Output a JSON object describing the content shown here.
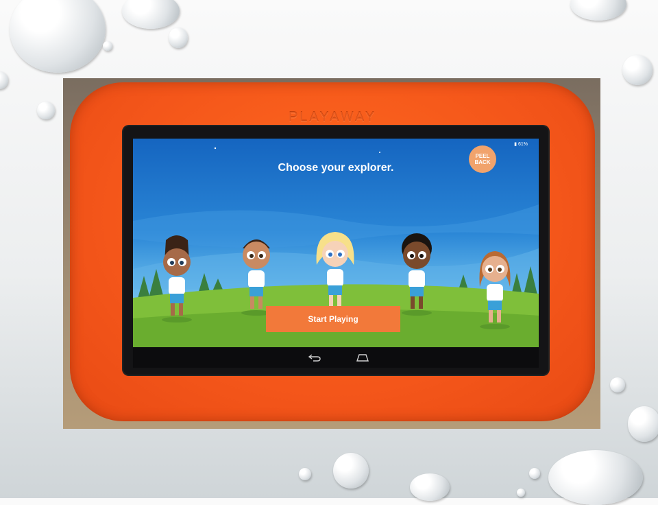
{
  "device": {
    "brand": "PLAYAWAY",
    "status": {
      "battery": "61%"
    }
  },
  "app": {
    "title": "Choose your explorer.",
    "peel_back": "PEEL BACK",
    "start_button": "Start Playing",
    "explorers": [
      {
        "name": "explorer-1",
        "selected": false
      },
      {
        "name": "explorer-2",
        "selected": false
      },
      {
        "name": "explorer-3",
        "selected": true
      },
      {
        "name": "explorer-4",
        "selected": false
      },
      {
        "name": "explorer-5",
        "selected": false
      }
    ]
  },
  "navbar": {
    "icons": [
      "back-icon",
      "home-icon"
    ]
  },
  "colors": {
    "bumper": "#f4561a",
    "sky": "#1f7ad0",
    "grass": "#7fbf3a",
    "button": "#f2793a"
  }
}
